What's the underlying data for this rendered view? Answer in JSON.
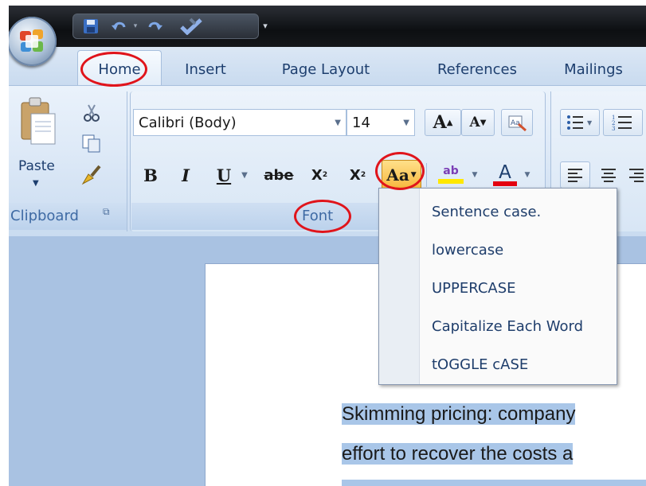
{
  "quick_access": {
    "save_icon": "save-icon",
    "undo_icon": "undo-icon",
    "redo_icon": "redo-icon",
    "spellcheck_icon": "spellcheck-icon",
    "customize_icon": "customize-icon"
  },
  "tabs": [
    {
      "label": "Home"
    },
    {
      "label": "Insert"
    },
    {
      "label": "Page Layout"
    },
    {
      "label": "References"
    },
    {
      "label": "Mailings"
    }
  ],
  "clipboard": {
    "paste_label": "Paste",
    "group_label": "Clipboard"
  },
  "font": {
    "family": "Calibri (Body)",
    "size": "14",
    "group_label": "Font",
    "bold_label": "B",
    "italic_label": "I",
    "underline_label": "U",
    "strike_label": "abe",
    "subscript_label": "X",
    "superscript_label": "X",
    "change_case_label": "Aa",
    "grow_label": "A",
    "shrink_label": "A",
    "highlight_label": "ab",
    "font_color_label": "A"
  },
  "change_case_menu": [
    {
      "label": "Sentence case."
    },
    {
      "label": "lowercase"
    },
    {
      "label": "UPPERCASE"
    },
    {
      "label": "Capitalize Each Word"
    },
    {
      "label": "tOGGLE cASE"
    }
  ],
  "document": {
    "line1": "Skimming pricing:  company",
    "line2": "effort to recover the costs a"
  },
  "colors": {
    "accent": "#e0141b",
    "highlight": "#ffe800",
    "font_color": "#e3000f"
  }
}
